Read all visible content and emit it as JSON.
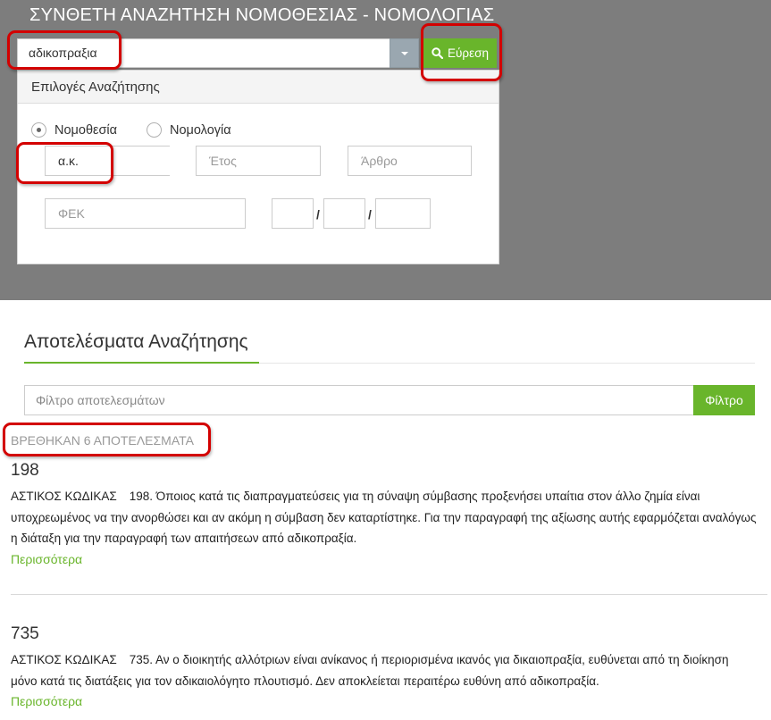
{
  "header": {
    "title": "ΣΥΝΘΕΤΗ ΑΝΑΖΗΤΗΣΗ ΝΟΜΟΘΕΣΙΑΣ - ΝΟΜΟΛΟΓΙΑΣ"
  },
  "search": {
    "value": "αδικοπραξια",
    "find_label": "Εύρεση",
    "find_icon": "search-icon"
  },
  "options": {
    "title": "Επιλογές Αναζήτησης",
    "radio_legislation": "Νομοθεσία",
    "radio_case_law": "Νομολογία",
    "selected": "Νομοθεσία",
    "code_value": "α.κ.",
    "year_placeholder": "Έτος",
    "article_placeholder": "Άρθρο",
    "fek_placeholder": "ΦΕΚ",
    "separator": "/"
  },
  "results": {
    "title": "Αποτελέσματα Αναζήτησης",
    "filter_placeholder": "Φίλτρο αποτελεσμάτων",
    "filter_label": "Φίλτρο",
    "count_text": "ΒΡΕΘΗΚΑΝ 6 ΑΠΟΤΕΛΕΣΜΑΤΑ",
    "items": [
      {
        "number": "198",
        "source": "ΑΣΤΙΚΟΣ ΚΩΔΙΚΑΣ",
        "text": "198. Όποιος κατά τις διαπραγματεύσεις για τη σύναψη σύμβασης προξενήσει υπαίτια στον άλλο ζημία είναι υποχρεωμένος να την ανορθώσει και αν ακόμη η σύμβαση δεν καταρτίστηκε. Για την παραγραφή της αξίωσης αυτής εφαρμόζεται αναλόγως η διάταξη για την παραγραφή των απαιτήσεων από αδικοπραξία.",
        "more": "Περισσότερα"
      },
      {
        "number": "735",
        "source": "ΑΣΤΙΚΟΣ ΚΩΔΙΚΑΣ",
        "text": "735. Αν ο διοικητής αλλότριων είναι ανίκανος ή περιορισμένα ικανός για δικαιοπραξία, ευθύνεται από τη διοίκηση μόνο κατά τις διατάξεις για τον αδικαιολόγητο πλουτισμό. Δεν αποκλείεται περαιτέρω ευθύνη από αδικοπραξία.",
        "more": "Περισσότερα"
      }
    ]
  },
  "colors": {
    "accent_green": "#69b52b",
    "header_gray": "#7d7d7d",
    "callout_red": "#d30000"
  }
}
